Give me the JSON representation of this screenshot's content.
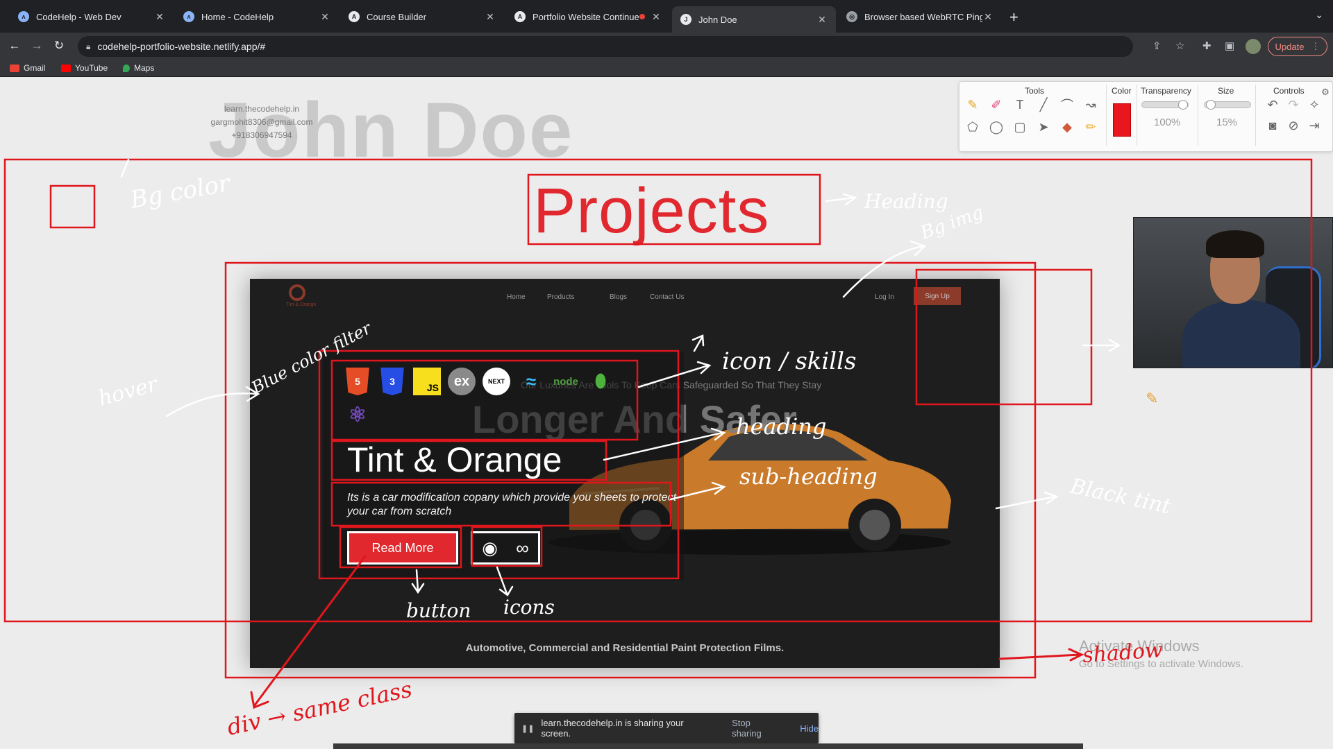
{
  "tabs": [
    {
      "title": "CodeHelp - Web Dev",
      "icon": "codehelp-icon"
    },
    {
      "title": "Home - CodeHelp",
      "icon": "codehelp-icon"
    },
    {
      "title": "Course Builder",
      "icon": "course-builder-icon"
    },
    {
      "title": "Portfolio Website Continue",
      "icon": "course-builder-icon",
      "recording": true
    },
    {
      "title": "John Doe",
      "icon": "site-icon",
      "active": true
    },
    {
      "title": "Browser based WebRTC Ping T",
      "icon": "globe-icon"
    }
  ],
  "address_bar": {
    "url": "codehelp-portfolio-website.netlify.app/#"
  },
  "update_button": {
    "label": "Update"
  },
  "bookmarks": [
    {
      "label": "Gmail",
      "icon": "gmail-icon",
      "color": "#ea4335"
    },
    {
      "label": "YouTube",
      "icon": "youtube-icon",
      "color": "#ff0000"
    },
    {
      "label": "Maps",
      "icon": "maps-icon",
      "color": "#34a853"
    }
  ],
  "page": {
    "hero_name": "John Doe",
    "contact": [
      "learn.thecodehelp.in",
      "gargmohit8306@gmail.com",
      "+918306947594"
    ],
    "section_heading": "Projects"
  },
  "draw_toolbar": {
    "tools_label": "Tools",
    "color_label": "Color",
    "transparency_label": "Transparency",
    "transparency_value": "100%",
    "size_label": "Size",
    "size_value": "15%",
    "controls_label": "Controls",
    "current_color": "#e8171e"
  },
  "project_card": {
    "nav": {
      "home": "Home",
      "products": "Products",
      "blogs": "Blogs",
      "contact": "Contact Us",
      "login": "Log In",
      "signup": "Sign Up",
      "logo_text": "Tint & Orange"
    },
    "bg_subtitle": "Our Luxuries Are Tools To Keep Cars Safeguarded So That They Stay",
    "bg_title": "Longer And Safer",
    "skills": [
      "HTML5",
      "CSS3",
      "JS",
      "ex",
      "NEXT",
      "tailwind",
      "node",
      "mongo",
      "redux"
    ],
    "title": "Tint & Orange",
    "description": "Its is a car modification copany which provide you sheets to protect your car from scratch",
    "read_more": "Read More",
    "footer": "Automotive, Commercial and Residential Paint Protection Films."
  },
  "annotations": {
    "bg_color": "Bg color",
    "heading": "Heading",
    "bg_img": "Bg img",
    "blue_color_filter": "Blue color filter",
    "hover": "hover",
    "icon_skills": "icon / skills",
    "heading_card": "heading",
    "sub_heading": "sub-heading",
    "black_tint": "Black tint",
    "button": "button",
    "icons": "icons",
    "shadow": "shadow",
    "div_same_class": "div → same class"
  },
  "watermark": {
    "title": "Activate Windows",
    "subtitle": "Go to Settings to activate Windows."
  },
  "share_bar": {
    "message": "learn.thecodehelp.in is sharing your screen.",
    "stop": "Stop sharing",
    "hide": "Hide"
  }
}
